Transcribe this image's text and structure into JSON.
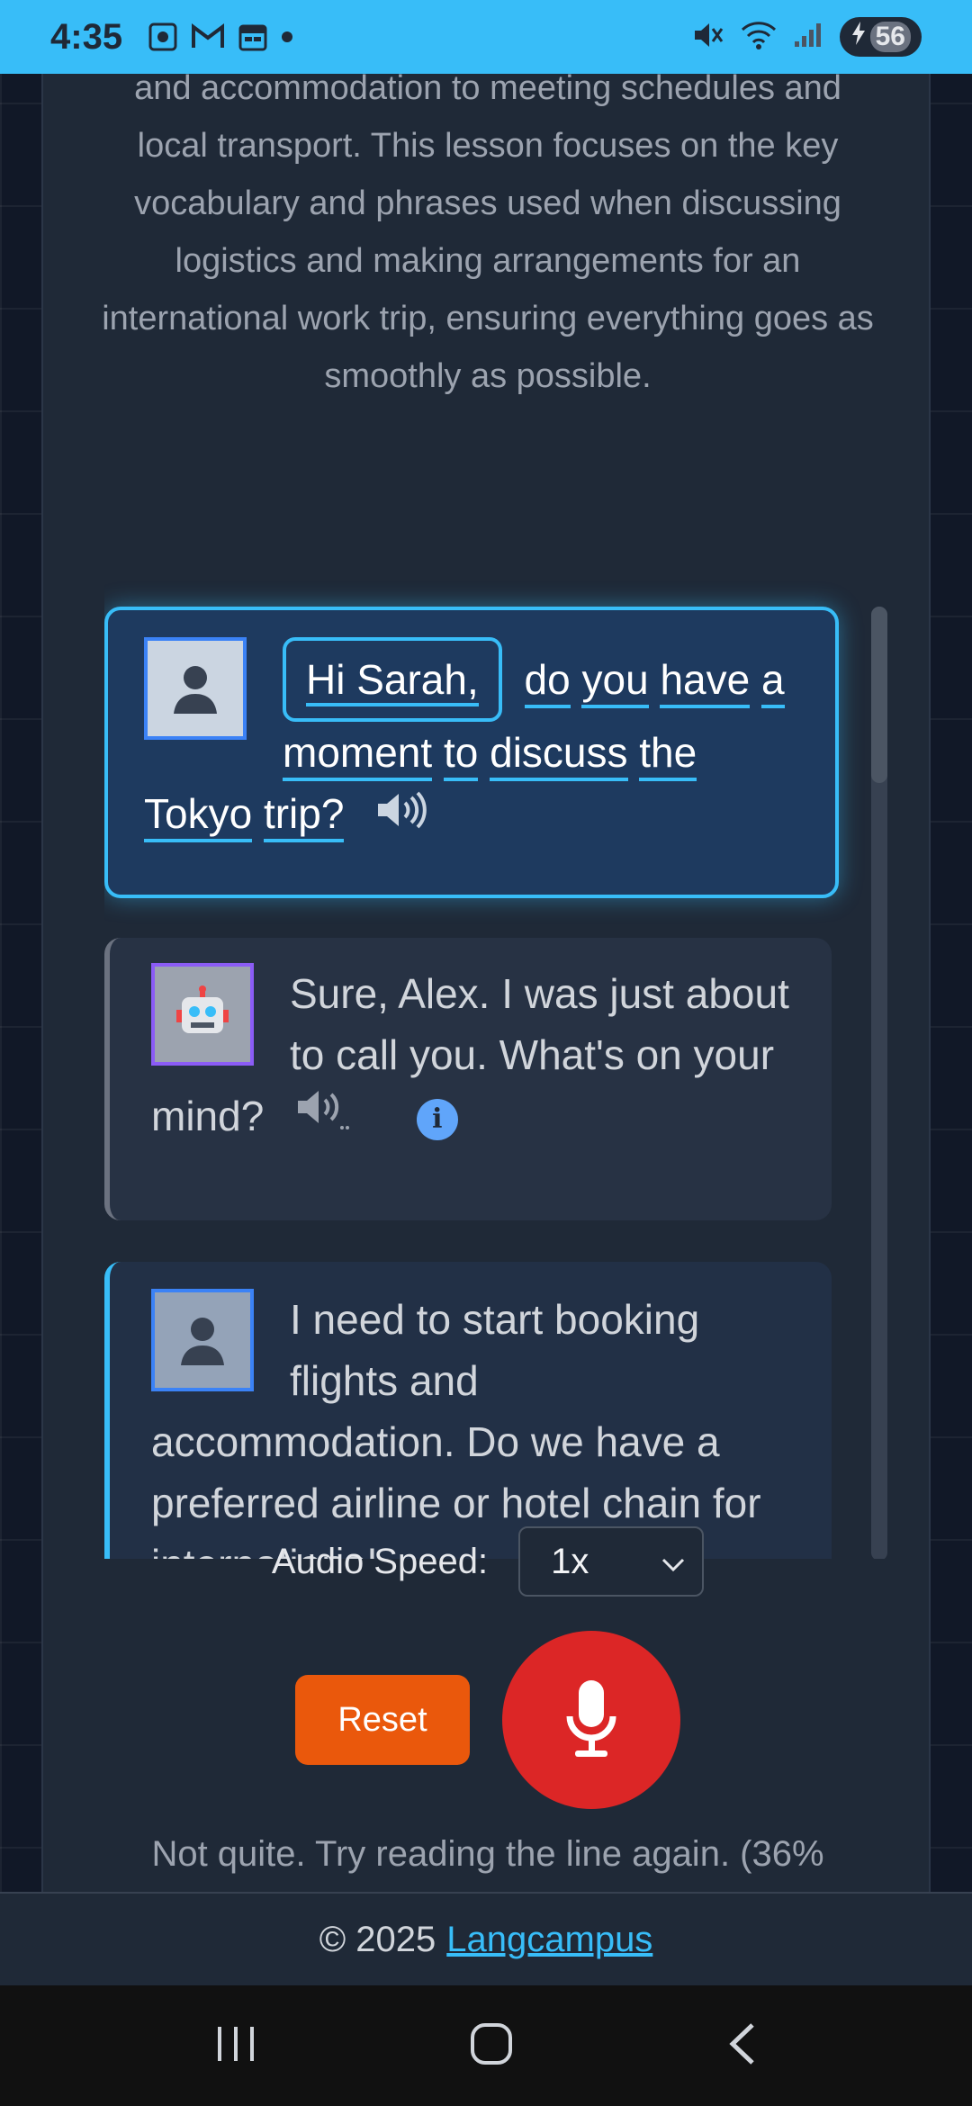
{
  "status": {
    "time": "4:35",
    "battery": "56"
  },
  "lesson": {
    "intro_text": "and accommodation to meeting schedules and local transport. This lesson focuses on the key vocabulary and phrases used when discussing logistics and making arrangements for an international work trip, ensuring everything goes as smoothly as possible."
  },
  "conversation": [
    {
      "speaker": "user",
      "avatar": "person-silhouette",
      "highlighted_word": "Hi Sarah,",
      "rest_words": [
        "do",
        "you",
        "have",
        "a",
        "moment",
        "to",
        "discuss",
        "the",
        "Tokyo",
        "trip?"
      ],
      "active": true
    },
    {
      "speaker": "bot",
      "avatar": "robot-face",
      "text": "Sure, Alex. I was just about to call you. What's on your mind?"
    },
    {
      "speaker": "user",
      "avatar": "person-silhouette",
      "text": "I need to start booking flights and accommodation. Do we have a preferred airline or hotel chain for international"
    }
  ],
  "controls": {
    "audio_speed_label": "Audio Speed:",
    "audio_speed_value": "1x",
    "reset_label": "Reset"
  },
  "feedback": {
    "text": "Not quite. Try reading the line again. (36%"
  },
  "footer": {
    "copyright": "© 2025",
    "link_text": "Langcampus"
  },
  "colors": {
    "accent": "#38bdf8",
    "reset": "#ea580c",
    "mic": "#dc2626",
    "background": "#111827",
    "card": "#1f2937"
  }
}
